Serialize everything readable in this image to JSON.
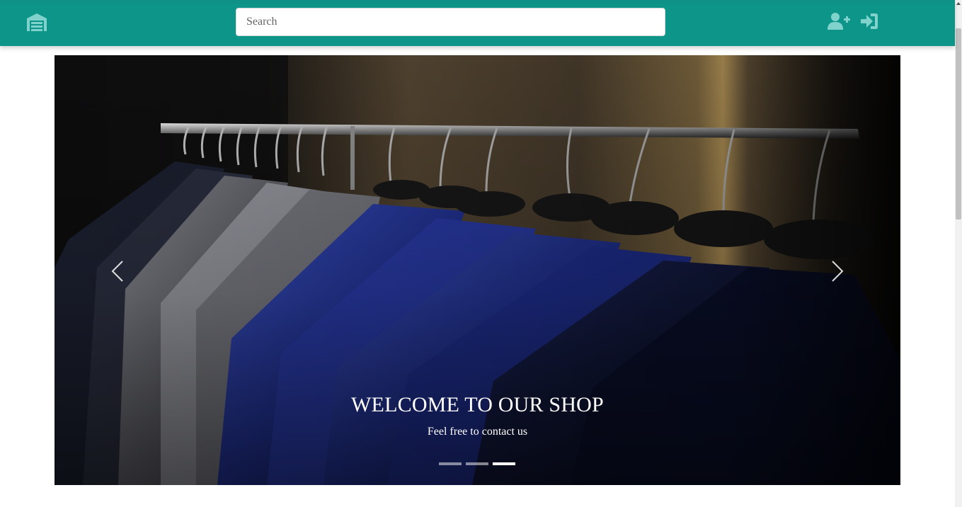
{
  "navbar": {
    "background_color": "#0d958a",
    "logo_icon": "garage-icon",
    "search": {
      "placeholder": "Search",
      "value": ""
    },
    "icons": [
      "user-plus-icon",
      "sign-in-icon"
    ]
  },
  "carousel": {
    "caption_title": "WELCOME TO OUR SHOP",
    "caption_text": "Feel free to contact us",
    "slide_count": 3,
    "active_slide": 3,
    "prev_icon": "chevron-left-icon",
    "next_icon": "chevron-right-icon"
  }
}
